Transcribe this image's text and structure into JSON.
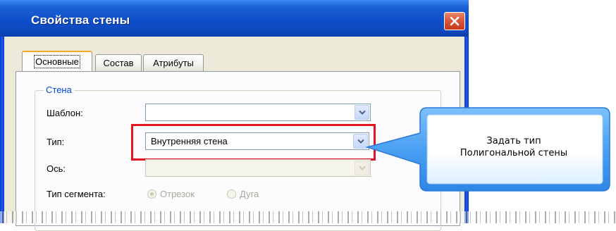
{
  "dialog": {
    "title": "Свойства стены",
    "tabs": [
      {
        "label": "Основные",
        "active": true
      },
      {
        "label": "Состав",
        "active": false
      },
      {
        "label": "Атрибуты",
        "active": false
      }
    ],
    "group_label": "Стена",
    "fields": {
      "template_label": "Шаблон:",
      "template_value": "",
      "type_label": "Тип:",
      "type_value": "Внутренняя стена",
      "axis_label": "Ось:",
      "axis_value": "",
      "segment_label": "Тип сегмента:",
      "segment_options": [
        {
          "label": "Отрезок",
          "selected": true
        },
        {
          "label": "Дуга",
          "selected": false
        }
      ]
    }
  },
  "callout": {
    "line1": "Задать тип",
    "line2": "Полигональной стены"
  },
  "colors": {
    "titlebar": "#0d48bd",
    "highlight": "#e3131f",
    "callout": "#5aa7f5",
    "group_label": "#0046d5"
  },
  "icons": [
    "close-icon",
    "chevron-down-icon",
    "radio-icon"
  ]
}
